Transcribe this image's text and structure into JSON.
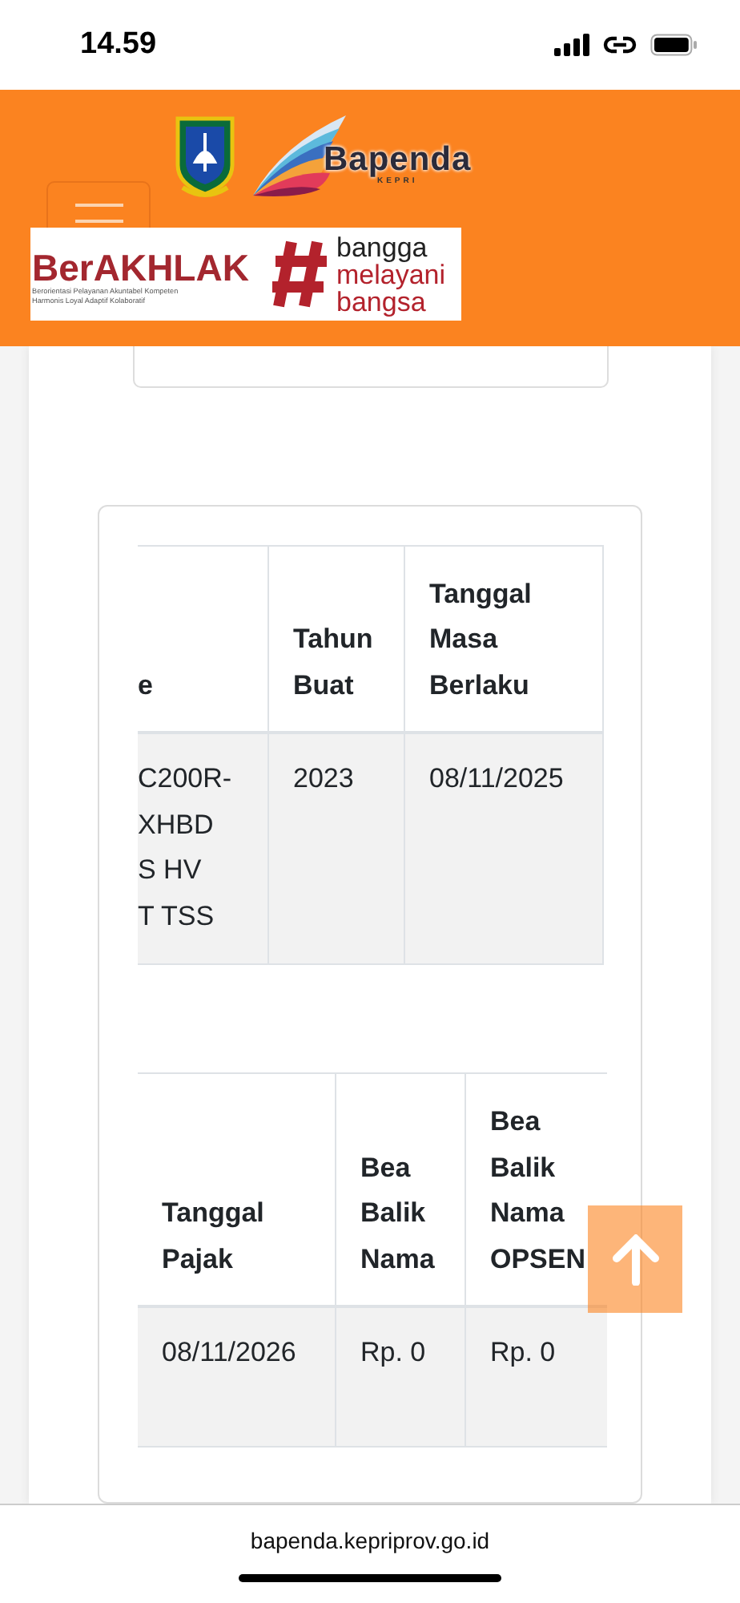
{
  "status_bar": {
    "time": "14.59"
  },
  "header": {
    "logo_text": "Bapenda",
    "logo_subtext": "KEPRI",
    "banner": {
      "title": "BerAKHLAK",
      "tagline_1": "Berorientasi Pelayanan Akuntabel Kompeten",
      "tagline_2": "Harmonis Loyal Adaptif Kolaboratif",
      "slogan": [
        "bangga",
        "melayani",
        "bangsa"
      ]
    }
  },
  "tables": [
    {
      "columns": [
        {
          "label": "e"
        },
        {
          "label": "Tahun Buat"
        },
        {
          "label": "Tanggal Masa Berlaku"
        }
      ],
      "rows": [
        [
          "C200R-\nXHBD\nS HV\nT TSS",
          "2023",
          "08/11/2025"
        ]
      ]
    },
    {
      "columns": [
        {
          "label": "Tanggal Pajak"
        },
        {
          "label": "Bea Balik Nama"
        },
        {
          "label": "Bea Balik Nama OPSEN"
        }
      ],
      "rows": [
        [
          "08/11/2026",
          "Rp. 0",
          "Rp. 0"
        ]
      ]
    }
  ],
  "browser": {
    "url": "bapenda.kepriprov.go.id"
  }
}
